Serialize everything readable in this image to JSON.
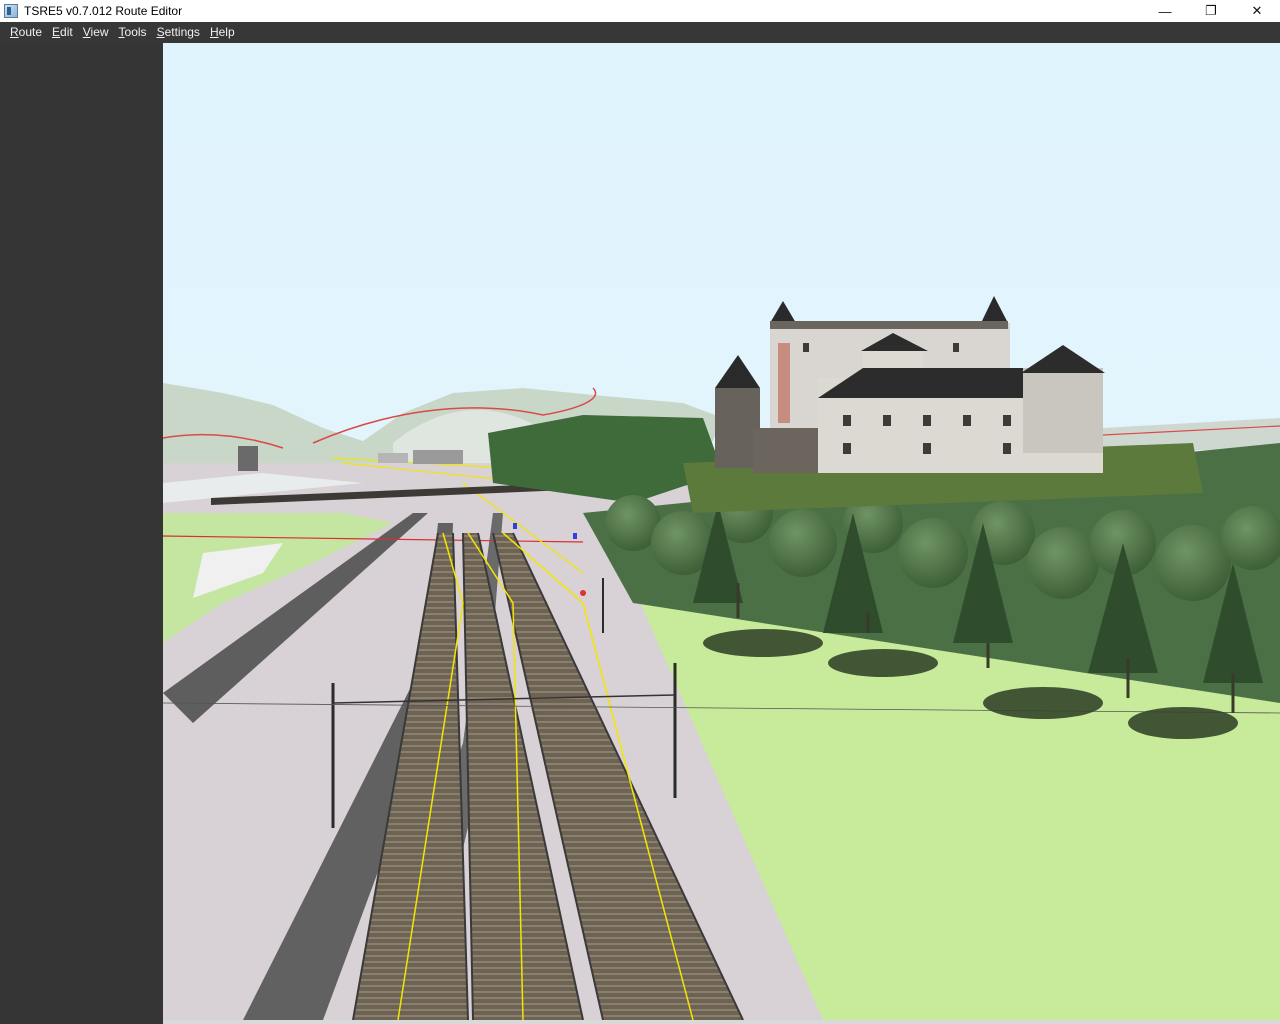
{
  "window": {
    "title": "TSRE5 v0.7.012 Route Editor",
    "controls": {
      "minimize": "—",
      "restore": "❐",
      "close": "✕"
    }
  },
  "menu": {
    "items": [
      {
        "label": "Route",
        "hotkey": "R"
      },
      {
        "label": "Edit",
        "hotkey": "E"
      },
      {
        "label": "View",
        "hotkey": "V"
      },
      {
        "label": "Tools",
        "hotkey": "T"
      },
      {
        "label": "Settings",
        "hotkey": "S"
      },
      {
        "label": "Help",
        "hotkey": "H"
      }
    ]
  },
  "viewport": {
    "icon": "3d-scene-view",
    "colors": {
      "sky": "#e2f5fd",
      "grass": "#c9eb9a",
      "ballast": "#d6cfd4",
      "hill": "#c8d6c6",
      "trees": "#3f6a3a",
      "castle_wall": "#dcd8d2",
      "roof": "#2a2a2a",
      "track_marker": "#f2e600"
    }
  }
}
